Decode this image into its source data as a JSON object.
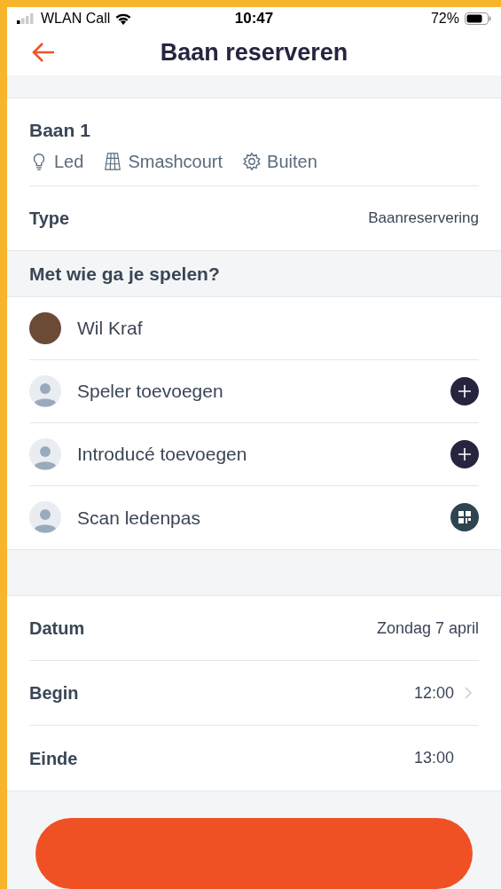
{
  "status_bar": {
    "carrier": "WLAN Call",
    "time": "10:47",
    "battery": "72%"
  },
  "header": {
    "title": "Baan reserveren"
  },
  "court": {
    "name": "Baan 1",
    "features": [
      {
        "kind": "light",
        "label": "Led"
      },
      {
        "kind": "court",
        "label": "Smashcourt"
      },
      {
        "kind": "outdoor",
        "label": "Buiten"
      }
    ],
    "type_label": "Type",
    "type_value": "Baanreservering"
  },
  "players_section": {
    "title": "Met wie ga je spelen?",
    "players": [
      {
        "kind": "self",
        "label": "Wil Kraf"
      },
      {
        "kind": "add",
        "label": "Speler toevoegen"
      },
      {
        "kind": "add",
        "label": "Introducé toevoegen"
      },
      {
        "kind": "scan",
        "label": "Scan ledenpas"
      }
    ]
  },
  "schedule": [
    {
      "label": "Datum",
      "value": "Zondag 7 april",
      "chevron": false
    },
    {
      "label": "Begin",
      "value": "12:00",
      "chevron": true
    },
    {
      "label": "Einde",
      "value": "13:00",
      "chevron": false
    }
  ]
}
